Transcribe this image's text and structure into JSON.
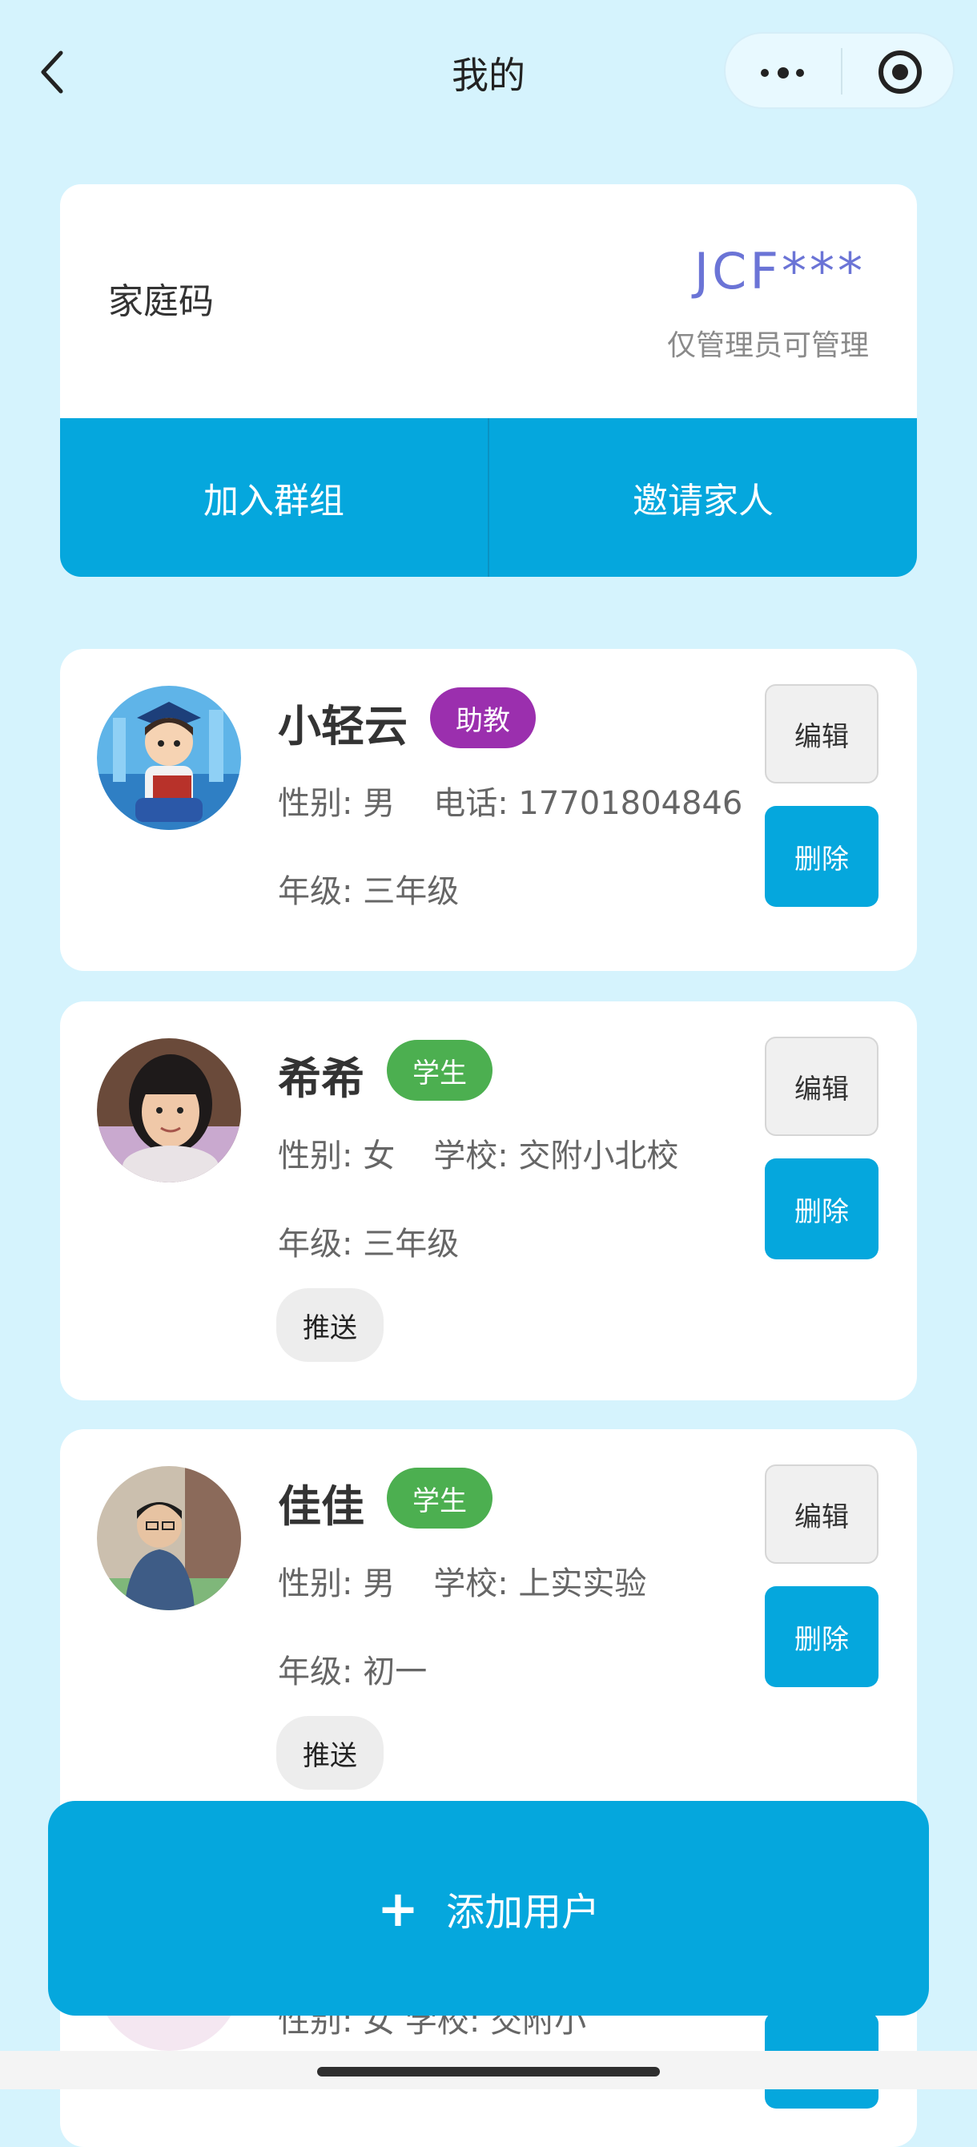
{
  "nav": {
    "title": "我的",
    "back_icon": "chevron-left-icon",
    "more_icon": "more-dots-icon",
    "close_icon": "target-circle-icon"
  },
  "family_code": {
    "label": "家庭码",
    "value": "JCF***",
    "note": "仅管理员可管理",
    "actions": [
      "加入群组",
      "邀请家人"
    ]
  },
  "members": [
    {
      "name": "小轻云",
      "role": "助教",
      "role_color": "#9b2fae",
      "line1": "性别: 男",
      "line2": "电话: 17701804846",
      "grade": "年级: 三年级",
      "edit": "编辑",
      "delete": "删除"
    },
    {
      "name": "希希",
      "role": "学生",
      "role_color": "#4caf50",
      "line1": "性别: 女",
      "line2": "学校: 交附小北校",
      "grade": "年级: 三年级",
      "push": "推送",
      "edit": "编辑",
      "delete": "删除"
    },
    {
      "name": "佳佳",
      "role": "学生",
      "role_color": "#4caf50",
      "line1": "性别: 男",
      "line2": "学校: 上实实验",
      "grade": "年级: 初一",
      "push": "推送",
      "edit": "编辑",
      "delete": "删除"
    }
  ],
  "partial_member": {
    "line": "性别: 女    学校: 交附小"
  },
  "add_user": {
    "icon": "plus-icon",
    "label": "添加用户"
  },
  "colors": {
    "background": "#d5f3fd",
    "primary": "#05a7dd",
    "code_accent": "#6b74d6"
  }
}
